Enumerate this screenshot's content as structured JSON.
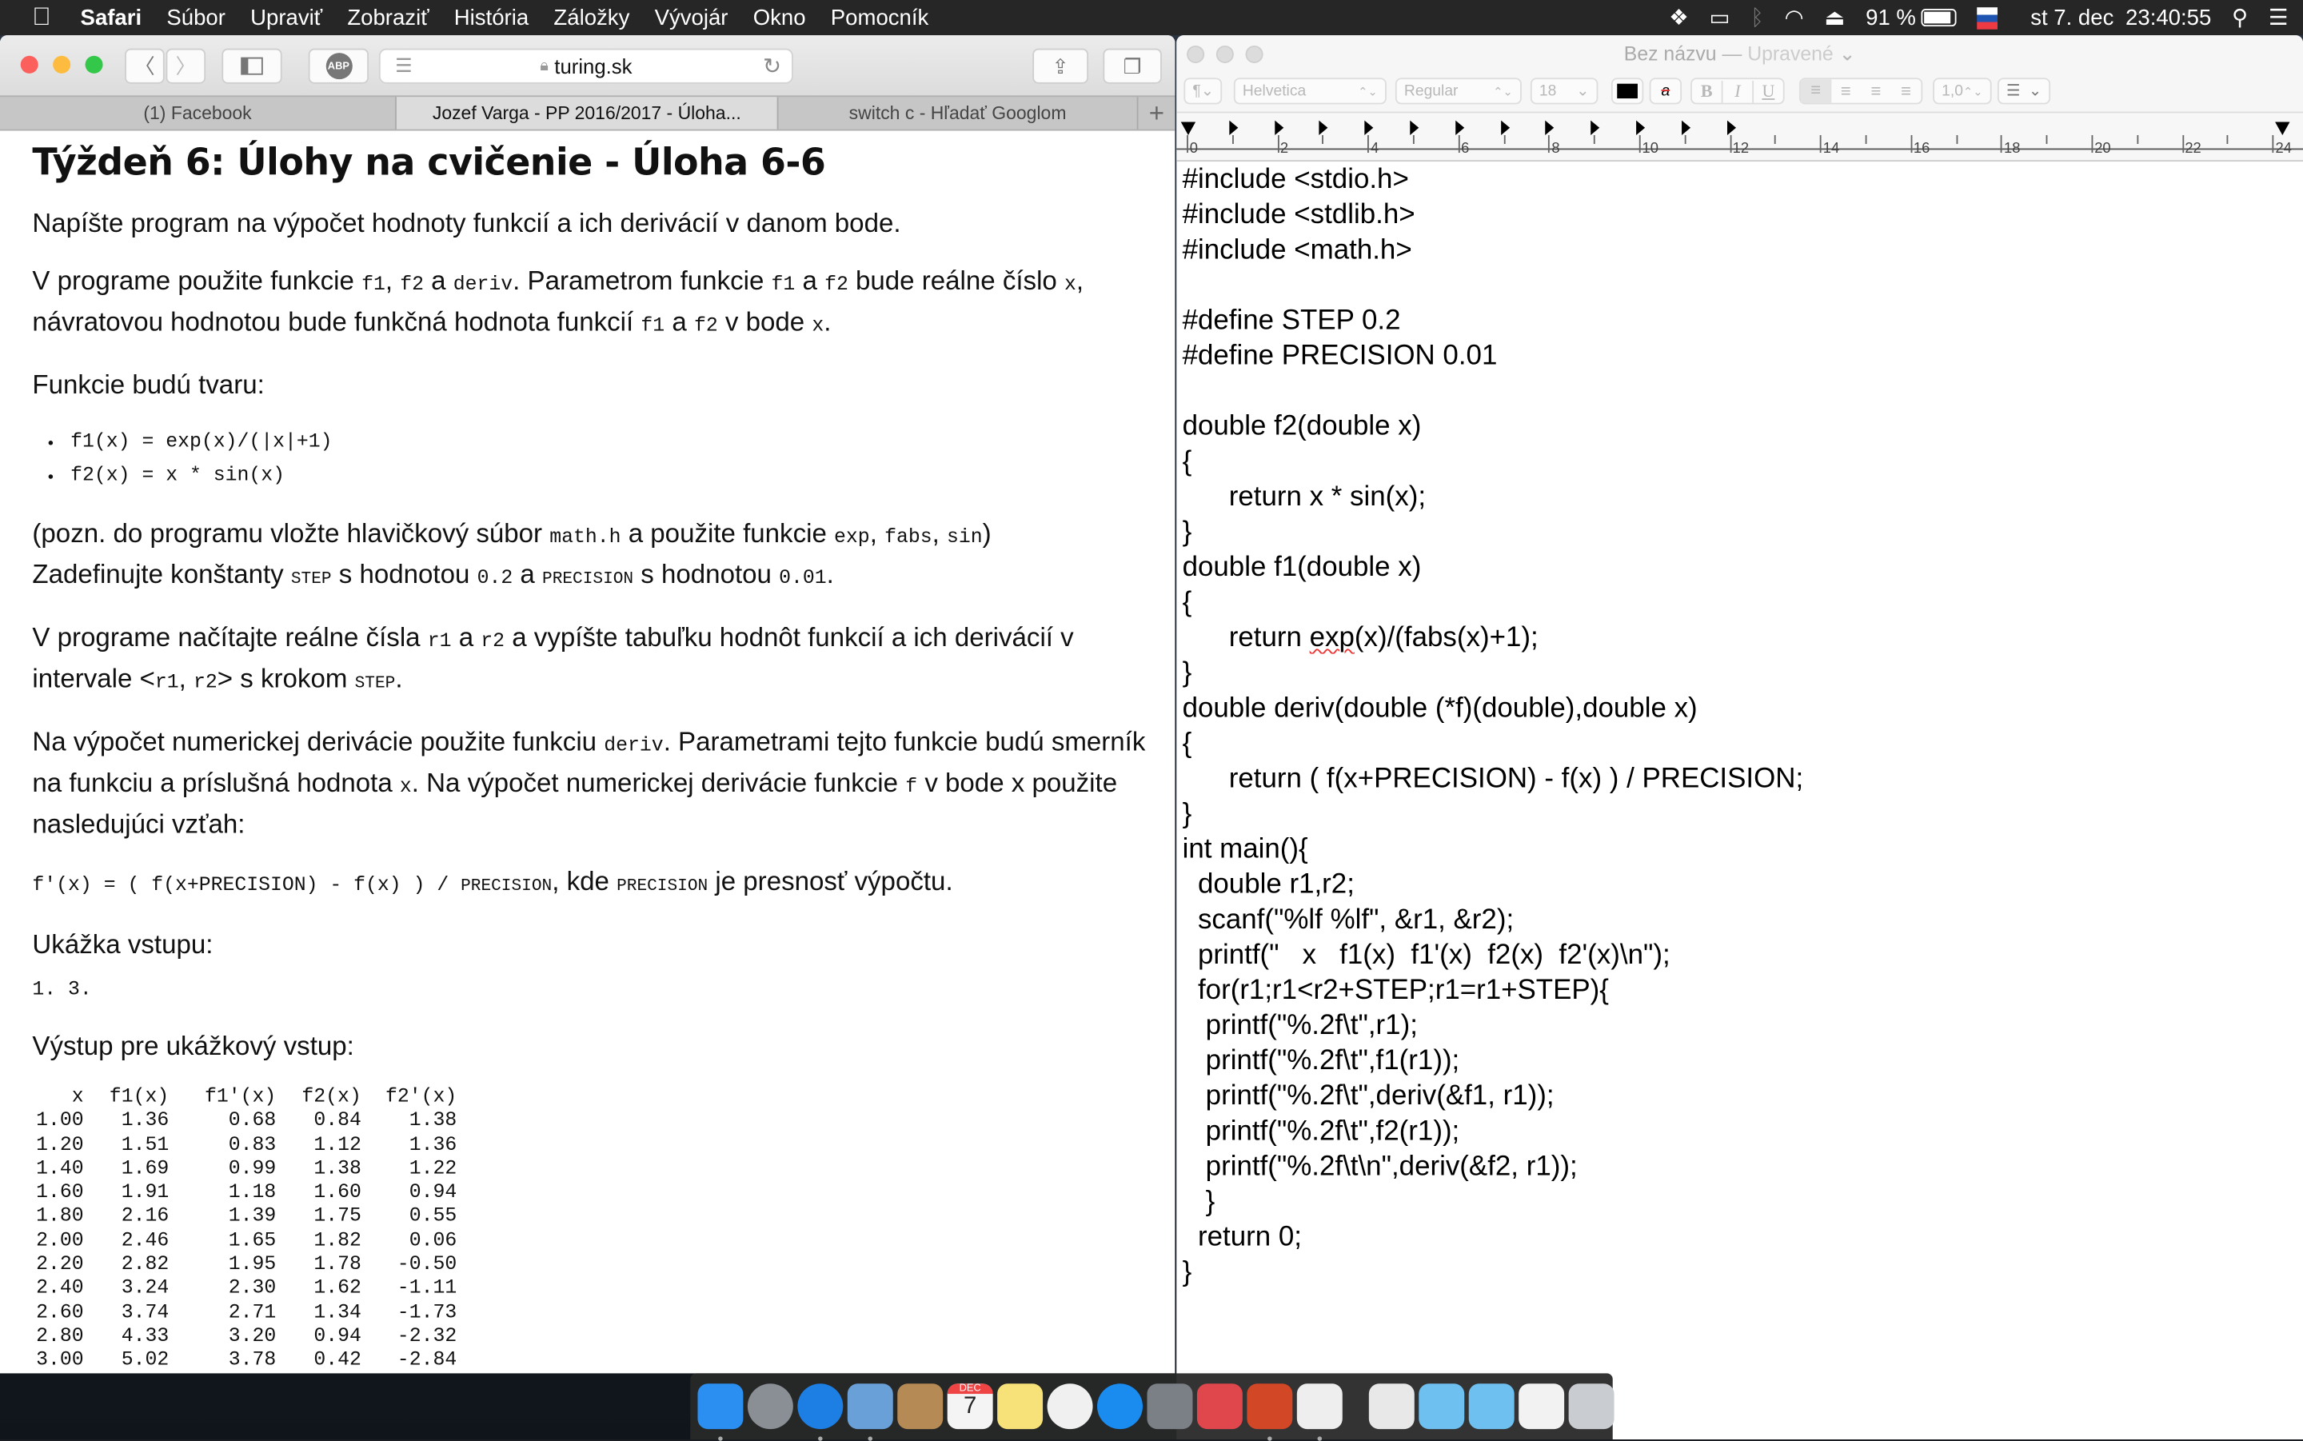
{
  "menubar": {
    "apple": "",
    "app": "Safari",
    "items": [
      "Súbor",
      "Upraviť",
      "Zobraziť",
      "História",
      "Záložky",
      "Vývojár",
      "Okno",
      "Pomocník"
    ],
    "battery": "91 %",
    "date": "st 7. dec",
    "time": "23:40:55",
    "icons": [
      "dropbox-icon",
      "display-icon",
      "bluetooth-icon",
      "wifi-icon",
      "airplay-icon",
      "battery-icon",
      "slovak-flag-icon",
      "spotlight-icon",
      "notification-center-icon"
    ]
  },
  "safari": {
    "toolbar": {
      "abp": "ABP",
      "address": "turing.sk"
    },
    "tabs": [
      {
        "label": "(1) Facebook",
        "active": false
      },
      {
        "label": "Jozef Varga - PP 2016/2017 - Úloha...",
        "active": true
      },
      {
        "label": "switch c - Hľadať Googlom",
        "active": false
      }
    ],
    "new_tab": "+",
    "content": {
      "title": "Týždeň 6: Úlohy na cvičenie - Úloha 6-6",
      "paragraphs": [
        [
          {
            "t": "Napíšte program na výpočet hodnoty funkcií a ich derivácií v danom bode."
          }
        ],
        [
          {
            "t": "V programe použite funkcie "
          },
          {
            "t": "f1",
            "c": 1
          },
          {
            "t": ", "
          },
          {
            "t": "f2",
            "c": 1
          },
          {
            "t": " a "
          },
          {
            "t": "deriv",
            "c": 1
          },
          {
            "t": ". Parametrom funkcie "
          },
          {
            "t": "f1",
            "c": 1
          },
          {
            "t": " a "
          },
          {
            "t": "f2",
            "c": 1
          },
          {
            "t": " bude reálne číslo "
          },
          {
            "t": "x",
            "c": 1
          },
          {
            "t": ", návratovou hodnotou bude funkčná hodnota funkcií "
          },
          {
            "t": "f1",
            "c": 1
          },
          {
            "t": " a "
          },
          {
            "t": "f2",
            "c": 1
          },
          {
            "t": " v bode "
          },
          {
            "t": "x",
            "c": 1
          },
          {
            "t": "."
          }
        ],
        [
          {
            "t": "Funkcie budú tvaru:"
          }
        ]
      ],
      "bullets": [
        "f1(x) = exp(x)/(|x|+1)",
        "f2(x) = x * sin(x)"
      ],
      "paragraphs2": [
        [
          {
            "t": "(pozn. do programu vložte hlavičkový súbor "
          },
          {
            "t": "math.h",
            "c": 1
          },
          {
            "t": " a použite funkcie "
          },
          {
            "t": "exp",
            "c": 1
          },
          {
            "t": ", "
          },
          {
            "t": "fabs",
            "c": 1
          },
          {
            "t": ", "
          },
          {
            "t": "sin",
            "c": 1
          },
          {
            "t": ")"
          },
          {
            "br": 1
          },
          {
            "t": "Zadefinujte konštanty "
          },
          {
            "t": "STEP",
            "s": 1
          },
          {
            "t": " s hodnotou "
          },
          {
            "t": "0.2",
            "c": 1
          },
          {
            "t": " a "
          },
          {
            "t": "PRECISION",
            "s": 1
          },
          {
            "t": " s hodnotou "
          },
          {
            "t": "0.01",
            "c": 1
          },
          {
            "t": "."
          }
        ],
        [
          {
            "t": "V programe načítajte reálne čísla "
          },
          {
            "t": "r1",
            "c": 1
          },
          {
            "t": " a "
          },
          {
            "t": "r2",
            "c": 1
          },
          {
            "t": " a vypíšte tabuľku hodnôt funkcií a ich derivácií v intervale <"
          },
          {
            "t": "r1",
            "c": 1
          },
          {
            "t": ", "
          },
          {
            "t": "r2",
            "c": 1
          },
          {
            "t": "> s krokom "
          },
          {
            "t": "STEP",
            "s": 1
          },
          {
            "t": "."
          }
        ],
        [
          {
            "t": "Na výpočet numerickej derivácie použite funkciu "
          },
          {
            "t": "deriv",
            "c": 1
          },
          {
            "t": ". Parametrami tejto funkcie budú smerník na funkciu a príslušná hodnota "
          },
          {
            "t": "x",
            "c": 1
          },
          {
            "t": ". Na výpočet numerickej derivácie funkcie "
          },
          {
            "t": "f",
            "c": 1
          },
          {
            "t": " v bode x použite nasledujúci vzťah:"
          }
        ],
        [
          {
            "t": "f'(x) = ( f(x+PRECISION) - f(x) ) / ",
            "c": 1
          },
          {
            "t": "PRECISION",
            "s": 1
          },
          {
            "t": ", kde "
          },
          {
            "t": "PRECISION",
            "s": 1
          },
          {
            "t": " je presnosť výpočtu."
          }
        ]
      ],
      "input_heading": "Ukážka vstupu:",
      "input_value": "1. 3.",
      "output_heading": "Výstup pre ukážkový vstup:",
      "output_table": {
        "headers": [
          "x",
          "f1(x)",
          "f1'(x)",
          "f2(x)",
          "f2'(x)"
        ],
        "rows": [
          [
            "1.00",
            "1.36",
            "0.68",
            "0.84",
            "1.38"
          ],
          [
            "1.20",
            "1.51",
            "0.83",
            "1.12",
            "1.36"
          ],
          [
            "1.40",
            "1.69",
            "0.99",
            "1.38",
            "1.22"
          ],
          [
            "1.60",
            "1.91",
            "1.18",
            "1.60",
            "0.94"
          ],
          [
            "1.80",
            "2.16",
            "1.39",
            "1.75",
            "0.55"
          ],
          [
            "2.00",
            "2.46",
            "1.65",
            "1.82",
            "0.06"
          ],
          [
            "2.20",
            "2.82",
            "1.95",
            "1.78",
            "-0.50"
          ],
          [
            "2.40",
            "3.24",
            "2.30",
            "1.62",
            "-1.11"
          ],
          [
            "2.60",
            "3.74",
            "2.71",
            "1.34",
            "-1.73"
          ],
          [
            "2.80",
            "4.33",
            "3.20",
            "0.94",
            "-2.32"
          ],
          [
            "3.00",
            "5.02",
            "3.78",
            "0.42",
            "-2.84"
          ]
        ]
      }
    }
  },
  "textedit": {
    "title": "Bez názvu",
    "title_sep": " — ",
    "status": "Upravené",
    "status_chevron": "⌄",
    "toolbar": {
      "paragraph": "¶",
      "font": "Helvetica",
      "style": "Regular",
      "size": "18",
      "bold": "B",
      "italic": "I",
      "underline": "U",
      "spacing": "1,0",
      "stepper": "⌃⌄",
      "dropdown": "⌄"
    },
    "ruler": [
      "0",
      "2",
      "4",
      "6",
      "8",
      "10",
      "12",
      "14",
      "16",
      "18",
      "20",
      "22",
      "24"
    ],
    "lines": [
      "#include <stdio.h>",
      "#include <stdlib.h>",
      "#include <math.h>",
      "",
      "#define STEP 0.2",
      "#define PRECISION 0.01",
      "",
      "double f2(double x)",
      "{",
      "      return x * sin(x);",
      "}",
      "double f1(double x)",
      "{",
      "      return exp(x)/(fabs(x)+1);",
      "}",
      "double deriv(double (*f)(double),double x)",
      "{",
      "      return ( f(x+PRECISION) - f(x) ) / PRECISION;",
      "}",
      "int main(){",
      "  double r1,r2;",
      "  scanf(\"%lf %lf\", &r1, &r2);",
      "  printf(\"   x   f1(x)  f1'(x)  f2(x)  f2'(x)\\n\");",
      "  for(r1;r1<r2+STEP;r1=r1+STEP){",
      "   printf(\"%.2f\\t\",r1);",
      "   printf(\"%.2f\\t\",f1(r1));",
      "   printf(\"%.2f\\t\",deriv(&f1, r1));",
      "   printf(\"%.2f\\t\",f2(r1));",
      "   printf(\"%.2f\\t\\n\",deriv(&f2, r1));",
      "   }",
      "  return 0;",
      "}"
    ]
  },
  "dock": {
    "apps": [
      {
        "name": "finder",
        "color": "#2a8ff0",
        "running": true
      },
      {
        "name": "launchpad",
        "color": "#8a8f96",
        "running": false
      },
      {
        "name": "safari",
        "color": "#1d7fe3",
        "running": true
      },
      {
        "name": "mail",
        "color": "#6aa0d8",
        "running": true
      },
      {
        "name": "contacts",
        "color": "#b58a55",
        "running": false
      },
      {
        "name": "calendar",
        "color": "#f4f4f4",
        "running": false
      },
      {
        "name": "notes",
        "color": "#f7e27a",
        "running": false
      },
      {
        "name": "photos",
        "color": "#f0f0f0",
        "running": false
      },
      {
        "name": "app-store",
        "color": "#1a8cf0",
        "running": false
      },
      {
        "name": "system-preferences",
        "color": "#7b7f86",
        "running": false
      },
      {
        "name": "autocad",
        "color": "#e0474c",
        "running": false
      },
      {
        "name": "powerpoint",
        "color": "#d24726",
        "running": true
      },
      {
        "name": "textedit",
        "color": "#eeeeee",
        "running": true
      }
    ],
    "others": [
      {
        "name": "document",
        "color": "#e8e8e8"
      },
      {
        "name": "folder",
        "color": "#6ec0f0"
      },
      {
        "name": "folder",
        "color": "#6ec0f0"
      },
      {
        "name": "presentation",
        "color": "#f2f2f2"
      },
      {
        "name": "trash",
        "color": "#c9ccd0"
      }
    ],
    "calendar_month": "DEC",
    "calendar_day": "7"
  }
}
